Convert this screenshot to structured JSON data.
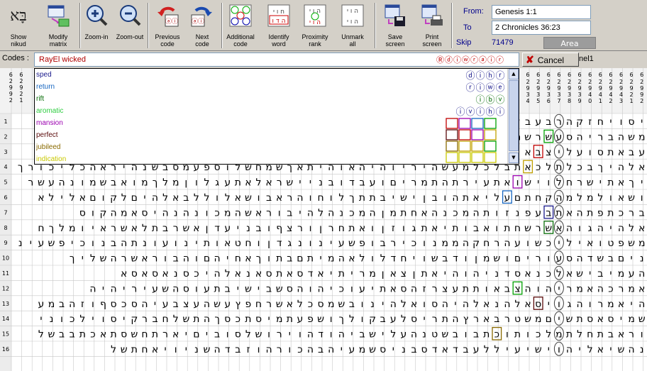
{
  "toolbar": {
    "buttons": [
      {
        "id": "show-nikud",
        "label": "Show\nnikud",
        "icon": "hebrew-letters-icon"
      },
      {
        "id": "modify-matrix",
        "label": "Modify\nmatrix",
        "icon": "matrix-icon"
      },
      {
        "id": "zoom-in",
        "label": "Zoom-in",
        "icon": "zoom-in-icon"
      },
      {
        "id": "zoom-out",
        "label": "Zoom-out",
        "icon": "zoom-out-icon"
      },
      {
        "id": "previous-code",
        "label": "Previous\ncode",
        "icon": "previous-arrow-icon"
      },
      {
        "id": "next-code",
        "label": "Next\ncode",
        "icon": "next-arrow-icon"
      },
      {
        "id": "additional-code",
        "label": "Additional\ncode",
        "icon": "additional-code-icon"
      },
      {
        "id": "identify-word",
        "label": "Identify\nword",
        "icon": "identify-word-icon"
      },
      {
        "id": "proximity-rank",
        "label": "Proximity\nrank",
        "icon": "proximity-icon"
      },
      {
        "id": "unmark-all",
        "label": "Unmark\nall",
        "icon": "unmark-icon"
      },
      {
        "id": "save-screen",
        "label": "Save\nscreen",
        "icon": "save-icon"
      },
      {
        "id": "print-screen",
        "label": "Print\nscreen",
        "icon": "print-icon"
      }
    ]
  },
  "range": {
    "from_label": "From:",
    "from_value": "Genesis 1:1",
    "to_label": "To",
    "to_value": "2 Chronicles 36:23",
    "skip_label": "Skip",
    "skip_value": "71479",
    "area_label": "Area"
  },
  "codes": {
    "label": "Codes :",
    "value": "RayEl wicked",
    "hebrew": "Ⓡⓓⓘⓦⓡⓐⓘⓡ",
    "cancel_label": "Cancel",
    "tab_text": "nel1"
  },
  "dropdown_items": [
    {
      "text": "sped",
      "color": "#1a1a8c"
    },
    {
      "text": "return",
      "color": "#1565c0"
    },
    {
      "text": "rift",
      "color": "#0a6e0a"
    },
    {
      "text": "aromatic",
      "color": "#2ecc40"
    },
    {
      "text": "mansion",
      "color": "#9b00b0"
    },
    {
      "text": "perfect",
      "color": "#5a0a0a"
    },
    {
      "text": "jubileed",
      "color": "#8a6a00"
    },
    {
      "text": "indication",
      "color": "#c8c800"
    }
  ],
  "column_numbers": [
    "6",
    "6",
    "6",
    "6",
    "6",
    "6",
    "6",
    "6",
    "6",
    "6",
    "6",
    "6",
    "6",
    "6",
    "6",
    "6",
    "6",
    "6",
    "6",
    "6"
  ],
  "column_sub": [
    "2 9 9 2",
    "2 9 2 1",
    "2 9 4 3",
    "2 9 4 2",
    "2 9 4 1",
    "2 9 4 0",
    "2 9 3 9",
    "2 9 3 8",
    "2 9 3 7",
    "2 9 3 6",
    "2 9 3 5",
    "2 9 3 4",
    "2 9 3 3"
  ],
  "row_numbers": [
    "1",
    "2",
    "3",
    "4",
    "5",
    "6",
    "7",
    "8",
    "9",
    "10",
    "11",
    "12",
    "13",
    "14",
    "15",
    "16"
  ],
  "rows": [
    "יסויחזקהרבעבל",
    "משהבריהסעשרשמן",
    "עבאתסועליצבאו",
    "אלהיךבכלתלכאתבלכלמעשהיריוהיהאוהיתאךשמחשלוספעמסבשנהיראהכליכורך",
    "יךאתישרחלוישואתעירתהתמריםועבדובניישראלאתעגלוןמלךמואבשמונהעשר",
    "ושאולמלמהקחתםעליאתהובןישיבתתךלוחוהראבושאלוללבאלהיםלקוםאלילא",
    "ברכתפתהאתבעפנזותהמכנהאחתמןהמכנהלהיבוראשהמכונהנהיסאמהקוס",
    "אלהיהגוהאשרשחתואבותיאתגוזןואתחרןורצףובניעדןאשרבתלאשראיומלךח",
    "משפטואיליכשועהרחקהממנוכירבופשעינונגדןוחטאותינועונתהבנוכיפשעינ",
    "ניםבשדהסעוריםושמןודבשויחדלולאהמיתםבתוךאחיהםוהבוראשרהשליך",
    "העמיבישאלכנאסדניהוהיאתןצאןמריתיאדסאתסאנאלהיכסנאסאסא",
    "אמרכהאמריהוהצבאותתעצרזהסאתיעוכיהוהסשבישיבתעוסהשעיריהיה",
    "היאמרוהגויסאלהנאלהיהסואלהינובשמסכלאשרחפץעשהעצבעיהסכסףוזהבמע",
    "שמיסאסתשיםמשטרבארץהתריסלעבקולךושפעתמיסתכסךהתשלחברקיסוילכוני",
    "וראבתחלתמלכותוכתבובשטנהעלישביהודהוירושלסוביםיארתחשסתאכתבבשל",
    "נהשיאליהוישיעיללעבדאדסבניסשמעיהבהכורהוזבדהשניויאחתשל"
  ]
}
